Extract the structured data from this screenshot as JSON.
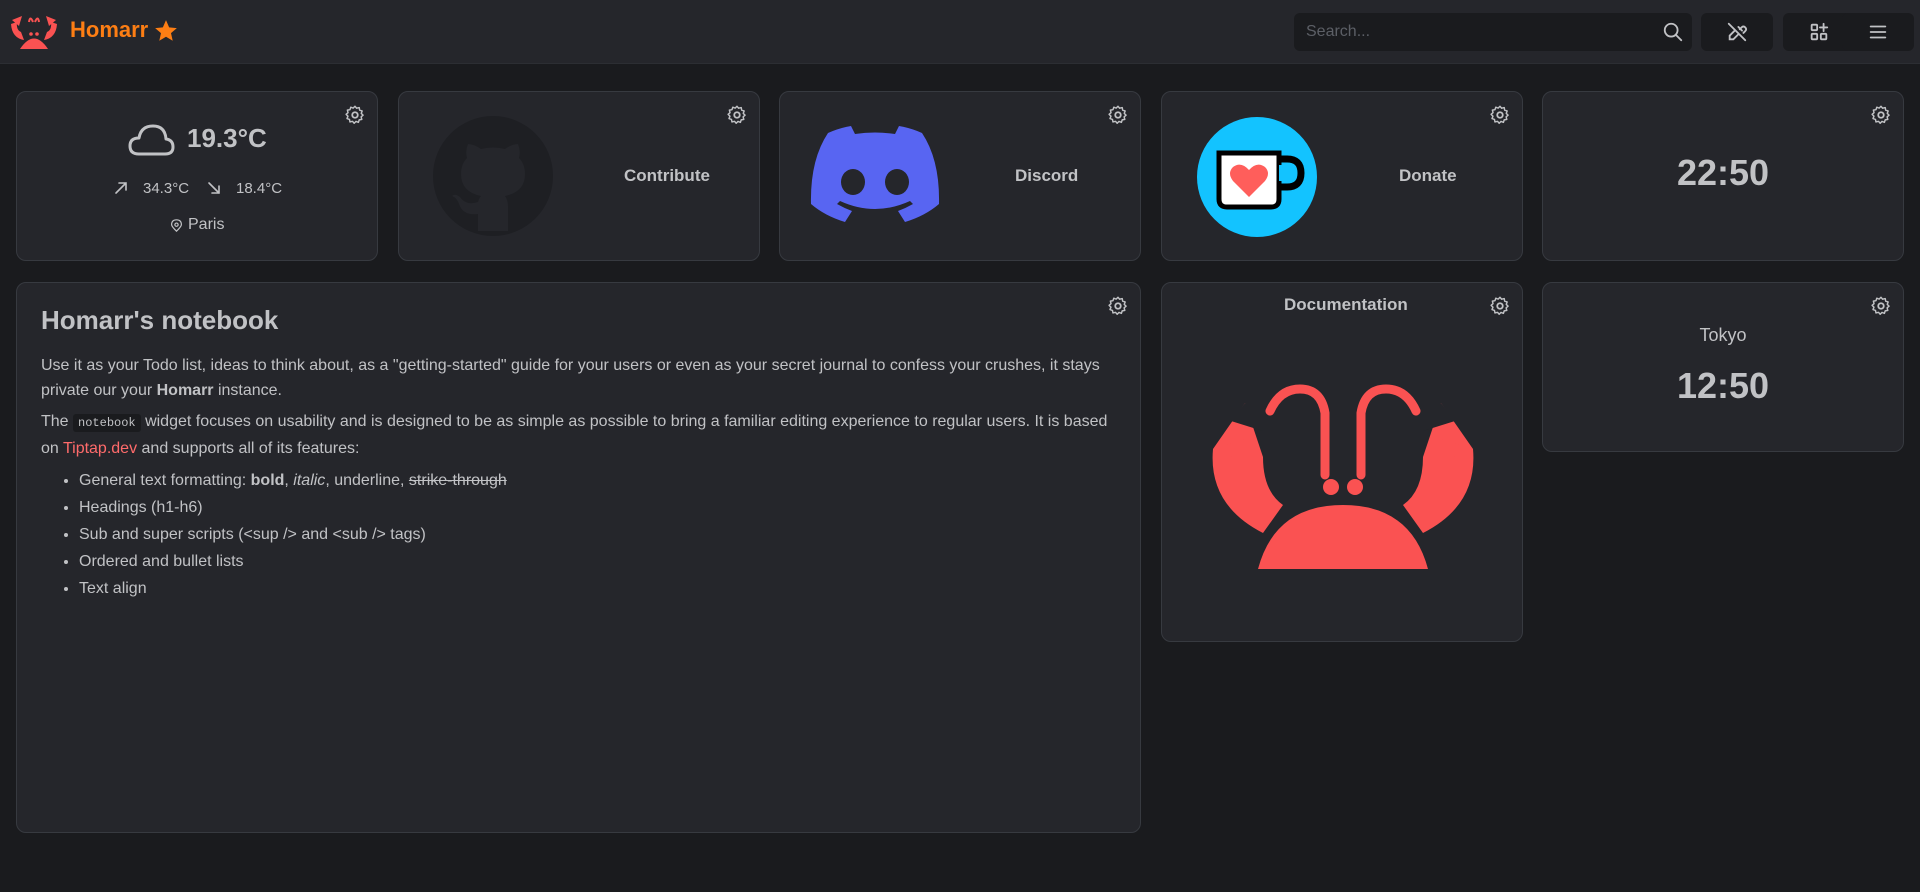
{
  "header": {
    "brand": "Homarr",
    "search_placeholder": "Search..."
  },
  "weather": {
    "temperature": "19.3°C",
    "high": "34.3°C",
    "low": "18.4°C",
    "location": "Paris"
  },
  "contribute": {
    "label": "Contribute"
  },
  "discord": {
    "label": "Discord"
  },
  "donate": {
    "label": "Donate"
  },
  "clock1": {
    "time": "22:50"
  },
  "notebook": {
    "title": "Homarr's notebook",
    "p1_a": "Use it as your Todo list, ideas to think about, as a \"getting-started\" guide for your users or even as your secret journal to confess your crushes, it stays private our your ",
    "p1_bold": "Homarr",
    "p1_b": " instance.",
    "p2_a": "The ",
    "p2_code": "notebook",
    "p2_b": " widget focuses on usability and is designed to be as simple as possible to bring a familiar editing experience to regular users. It is based on ",
    "p2_link": "Tiptap.dev",
    "p2_c": " and supports all of its features:",
    "li1_a": "General text formatting: ",
    "li1_bold": "bold",
    "li1_sep1": ", ",
    "li1_italic": "italic",
    "li1_sep2": ", underline, ",
    "li1_strike": "strike-through",
    "li2": "Headings (h1-h6)",
    "li3": "Sub and super scripts (<sup /> and <sub /> tags)",
    "li4": "Ordered and bullet lists",
    "li5": "Text align"
  },
  "documentation": {
    "label": "Documentation"
  },
  "clock2": {
    "city": "Tokyo",
    "time": "12:50"
  },
  "colors": {
    "accent": "#fd7e14",
    "discord": "#5865f2",
    "kofi": "#13c3ff",
    "crab": "#fa5252"
  }
}
